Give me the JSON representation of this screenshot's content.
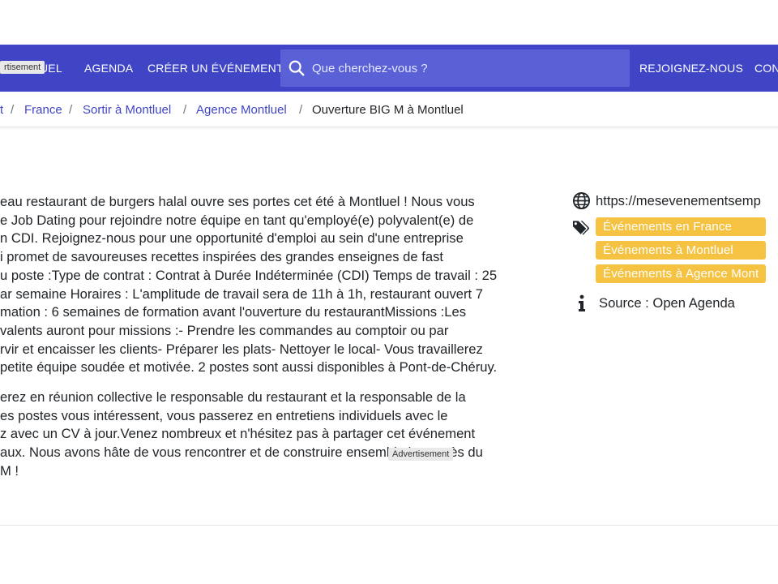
{
  "header": {
    "nav_left": [
      "UEL",
      "AGENDA",
      "CRÉER UN ÉVÉNEMENT"
    ],
    "search_placeholder": "Que cherchez-vous ?",
    "nav_right": [
      "REJOIGNEZ-NOUS",
      "CON"
    ],
    "ad_label": "rtisement",
    "accent": "#3f45c5"
  },
  "breadcrumb": {
    "items": [
      "t",
      "France",
      "Sortir à Montluel",
      "Agence Montluel"
    ],
    "current": "Ouverture BIG M à Montluel"
  },
  "description": {
    "paragraph1": [
      "eau restaurant de burgers halal ouvre ses portes cet été à Montluel ! Nous vous",
      "e Job Dating pour rejoindre notre équipe en tant qu'employé(e) polyvalent(e) de",
      "n CDI. Rejoignez-nous pour une opportunité d'emploi au sein d'une entreprise",
      "i promet de savoureuses recettes inspirées des grandes enseignes de fast",
      "u poste :Type de contrat : Contrat à Durée Indéterminée (CDI) Temps de travail : 25",
      "ar semaine Horaires : L'amplitude de travail sera de 11h à 1h, restaurant ouvert 7",
      "mation : 6 semaines de formation avant l'ouverture du restaurantMissions :Les",
      "valents auront pour missions :- Prendre les commandes au comptoir ou par",
      "rvir et encaisser les clients- Préparer les plats- Nettoyer le local- Vous travaillerez",
      "petite équipe soudée et motivée. 2 postes sont aussi disponibles à Pont-de-Chéruy."
    ],
    "paragraph2": [
      "erez en réunion collective le responsable du restaurant et la responsable de la",
      "es postes vous intéressent, vous passerez en entretiens individuels avec le",
      "z avec un CV à jour.Venez nombreux et n'hésitez pas à partager cet événement",
      "aux. Nous avons hâte de vous rencontrer et de construire ensemble le succès du",
      "M !"
    ],
    "ad_label": "Advertisement"
  },
  "sidebar": {
    "url": "https://mesevenementsemp",
    "tags": [
      "Événements en France",
      "Événements à Montluel",
      "Événements à Agence Mont"
    ],
    "source": "Source : Open Agenda",
    "tag_color": "#f5c242"
  }
}
